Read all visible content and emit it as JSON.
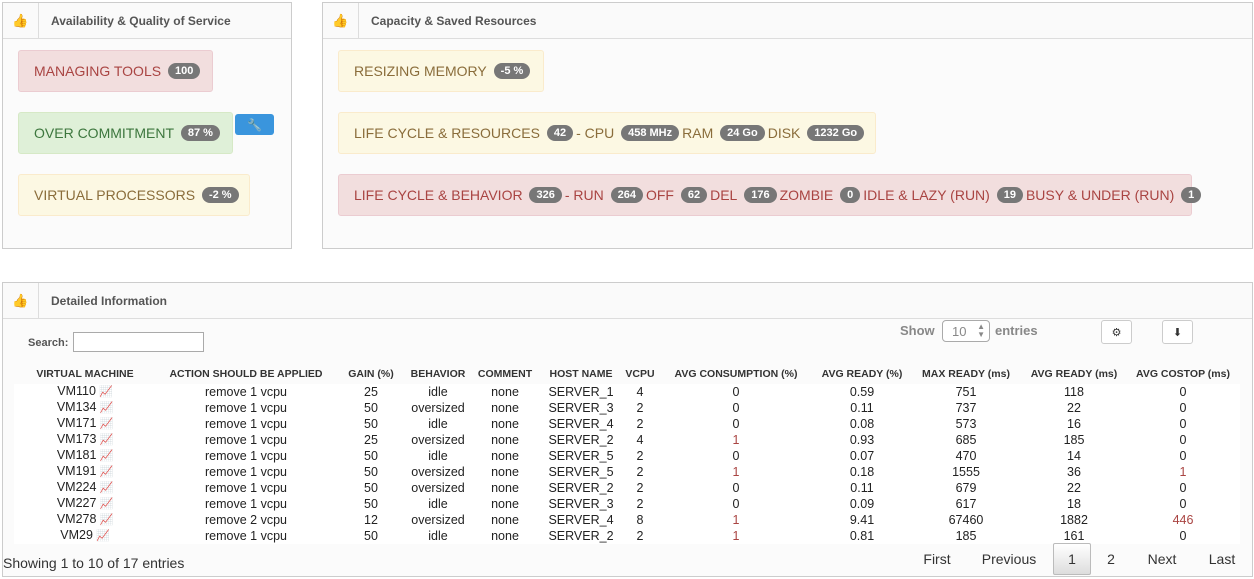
{
  "panels": {
    "availability": {
      "title": "Availability & Quality of Service",
      "icon": "thumbs-up-icon",
      "managing_tools": {
        "label": "MANAGING TOOLS",
        "badge": "100"
      },
      "over_commitment": {
        "label": "OVER COMMITMENT",
        "badge": "87 %"
      },
      "virtual_processors": {
        "label": "VIRTUAL PROCESSORS",
        "badge": "-2 %"
      }
    },
    "capacity": {
      "title": "Capacity & Saved Resources",
      "icon": "thumbs-up-icon",
      "resizing_memory": {
        "label": "RESIZING MEMORY",
        "badge": "-5 %"
      },
      "life_cycle_resources": {
        "label": "LIFE CYCLE & RESOURCES",
        "badge": "42",
        "cpu_label": "- CPU",
        "cpu": "458 MHz",
        "ram_label": "RAM",
        "ram": "24 Go",
        "disk_label": "DISK",
        "disk": "1232 Go"
      },
      "life_cycle_behavior": {
        "label": "LIFE CYCLE & BEHAVIOR",
        "badge": "326",
        "run_label": "- RUN",
        "run": "264",
        "off_label": "OFF",
        "off": "62",
        "del_label": "DEL",
        "del": "176",
        "zombie_label": "ZOMBIE",
        "zombie": "0",
        "idle_label": "IDLE & LAZY (RUN)",
        "idle": "19",
        "busy_label": "BUSY & UNDER (RUN)",
        "busy": "1"
      }
    },
    "detailed": {
      "title": "Detailed Information",
      "icon": "thumbs-up-icon"
    }
  },
  "colors": {
    "danger": "#a94442",
    "success": "#3c763d",
    "warning": "#8a6d3b",
    "accent": "#3a95dd"
  },
  "controls": {
    "search_label": "Search:",
    "search_value": "",
    "show_label": "Show",
    "entries_value": "10",
    "entries_label": "entries"
  },
  "table": {
    "headers": [
      "VIRTUAL MACHINE",
      "ACTION SHOULD BE APPLIED",
      "GAIN (%)",
      "BEHAVIOR",
      "COMMENT",
      "HOST NAME",
      "VCPU",
      "AVG CONSUMPTION (%)",
      "AVG READY (%)",
      "MAX READY (ms)",
      "AVG READY (ms)",
      "AVG COSTOP (ms)"
    ],
    "rows": [
      [
        "VM110",
        "remove 1 vcpu",
        "25",
        "idle",
        "none",
        "SERVER_1",
        "4",
        "0",
        "0.59",
        "751",
        "118",
        "0"
      ],
      [
        "VM134",
        "remove 1 vcpu",
        "50",
        "oversized",
        "none",
        "SERVER_3",
        "2",
        "0",
        "0.11",
        "737",
        "22",
        "0"
      ],
      [
        "VM171",
        "remove 1 vcpu",
        "50",
        "idle",
        "none",
        "SERVER_4",
        "2",
        "0",
        "0.08",
        "573",
        "16",
        "0"
      ],
      [
        "VM173",
        "remove 1 vcpu",
        "25",
        "oversized",
        "none",
        "SERVER_2",
        "4",
        "1",
        "0.93",
        "685",
        "185",
        "0"
      ],
      [
        "VM181",
        "remove 1 vcpu",
        "50",
        "idle",
        "none",
        "SERVER_5",
        "2",
        "0",
        "0.07",
        "470",
        "14",
        "0"
      ],
      [
        "VM191",
        "remove 1 vcpu",
        "50",
        "oversized",
        "none",
        "SERVER_5",
        "2",
        "1",
        "0.18",
        "1555",
        "36",
        "1"
      ],
      [
        "VM224",
        "remove 1 vcpu",
        "50",
        "oversized",
        "none",
        "SERVER_2",
        "2",
        "0",
        "0.11",
        "679",
        "22",
        "0"
      ],
      [
        "VM227",
        "remove 1 vcpu",
        "50",
        "idle",
        "none",
        "SERVER_3",
        "2",
        "0",
        "0.09",
        "617",
        "18",
        "0"
      ],
      [
        "VM278",
        "remove 2 vcpu",
        "12",
        "oversized",
        "none",
        "SERVER_4",
        "8",
        "1",
        "9.41",
        "67460",
        "1882",
        "446"
      ],
      [
        "VM29",
        "remove 1 vcpu",
        "50",
        "idle",
        "none",
        "SERVER_2",
        "2",
        "1",
        "0.81",
        "185",
        "161",
        "0"
      ]
    ]
  },
  "footer": {
    "info": "Showing 1 to 10 of 17 entries",
    "first": "First",
    "previous": "Previous",
    "pages": [
      "1",
      "2"
    ],
    "current_page": "1",
    "next": "Next",
    "last": "Last"
  }
}
